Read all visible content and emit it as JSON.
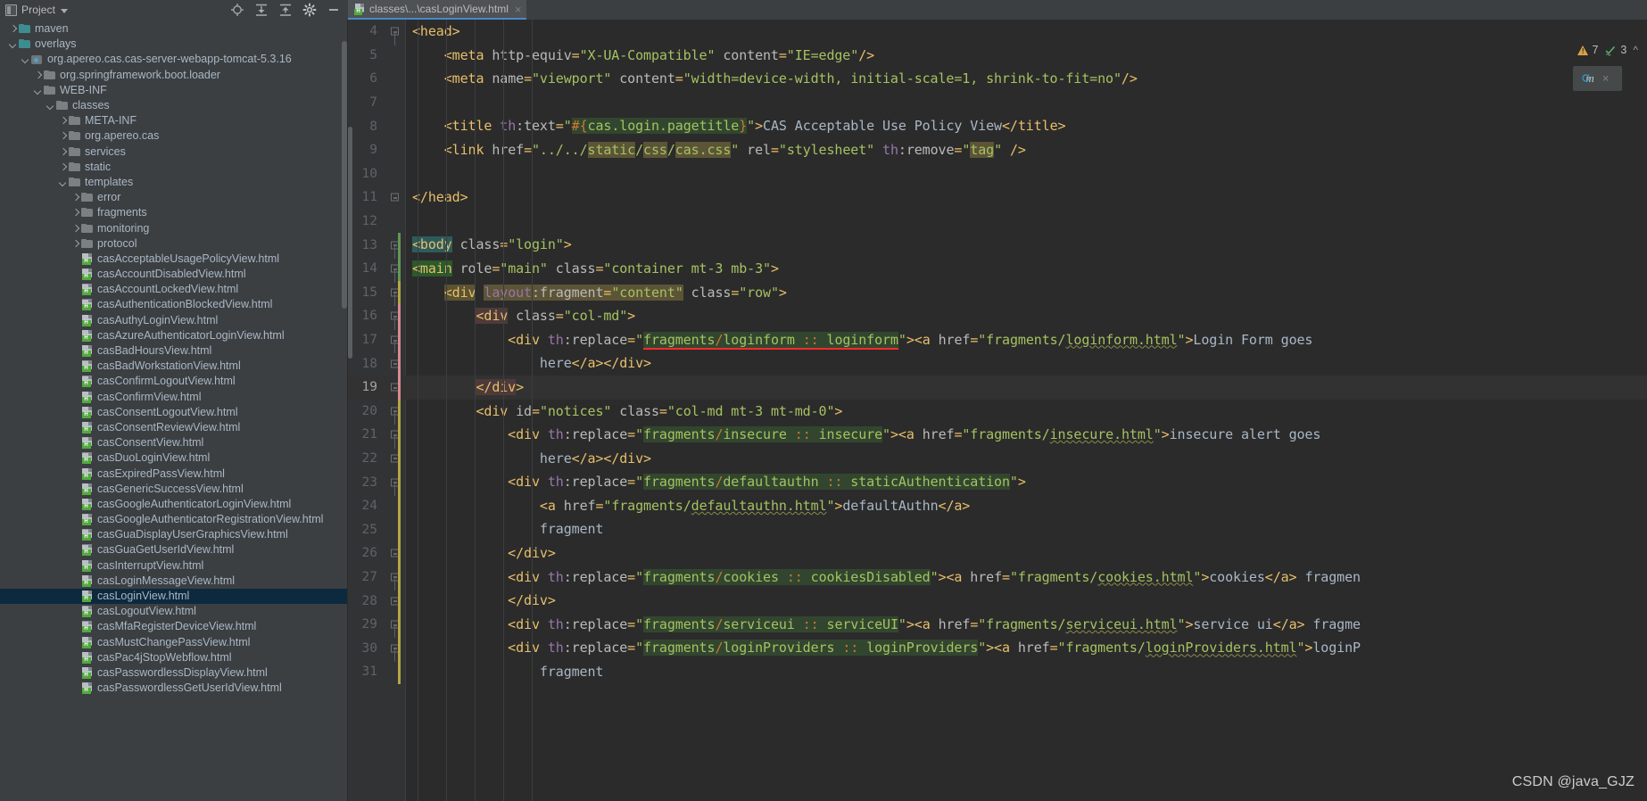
{
  "toolwindow": {
    "title": "Project",
    "icons": [
      "locate-icon",
      "expand-all-icon",
      "collapse-all-icon",
      "settings-gear-icon",
      "minimize-icon"
    ]
  },
  "tab": {
    "label": "classes\\...\\casLoginView.html",
    "icon": "html-file-icon",
    "close": "×"
  },
  "inspections": {
    "warning_icon": "warning-triangle-icon",
    "warning_count": "7",
    "ok_icon": "inspection-ok-icon",
    "ok_count": "3",
    "chevron": "^"
  },
  "maven_badge": {
    "letter": "m",
    "icon": "maven-reload-icon",
    "close": "×"
  },
  "watermark": "CSDN @java_GJZ",
  "tree": [
    {
      "indent": 1,
      "arrow": "right",
      "icon": "folder",
      "label": "maven"
    },
    {
      "indent": 1,
      "arrow": "down",
      "icon": "folder",
      "label": "overlays"
    },
    {
      "indent": 2,
      "arrow": "down",
      "icon": "module",
      "label": "org.apereo.cas.cas-server-webapp-tomcat-5.3.16"
    },
    {
      "indent": 3,
      "arrow": "right",
      "icon": "folder-gray",
      "label": "org.springframework.boot.loader"
    },
    {
      "indent": 3,
      "arrow": "down",
      "icon": "folder-gray",
      "label": "WEB-INF"
    },
    {
      "indent": 4,
      "arrow": "down",
      "icon": "folder-gray",
      "label": "classes"
    },
    {
      "indent": 5,
      "arrow": "right",
      "icon": "folder-gray",
      "label": "META-INF"
    },
    {
      "indent": 5,
      "arrow": "right",
      "icon": "folder-gray",
      "label": "org.apereo.cas"
    },
    {
      "indent": 5,
      "arrow": "right",
      "icon": "folder-gray",
      "label": "services"
    },
    {
      "indent": 5,
      "arrow": "right",
      "icon": "folder-gray",
      "label": "static"
    },
    {
      "indent": 5,
      "arrow": "down",
      "icon": "folder-gray",
      "label": "templates"
    },
    {
      "indent": 6,
      "arrow": "right",
      "icon": "folder-gray",
      "label": "error"
    },
    {
      "indent": 6,
      "arrow": "right",
      "icon": "folder-gray",
      "label": "fragments"
    },
    {
      "indent": 6,
      "arrow": "right",
      "icon": "folder-gray",
      "label": "monitoring"
    },
    {
      "indent": 6,
      "arrow": "right",
      "icon": "folder-gray",
      "label": "protocol"
    },
    {
      "indent": 6,
      "arrow": "none",
      "icon": "html-file",
      "label": "casAcceptableUsagePolicyView.html"
    },
    {
      "indent": 6,
      "arrow": "none",
      "icon": "html-file",
      "label": "casAccountDisabledView.html"
    },
    {
      "indent": 6,
      "arrow": "none",
      "icon": "html-file",
      "label": "casAccountLockedView.html"
    },
    {
      "indent": 6,
      "arrow": "none",
      "icon": "html-file",
      "label": "casAuthenticationBlockedView.html"
    },
    {
      "indent": 6,
      "arrow": "none",
      "icon": "html-file",
      "label": "casAuthyLoginView.html"
    },
    {
      "indent": 6,
      "arrow": "none",
      "icon": "html-file",
      "label": "casAzureAuthenticatorLoginView.html"
    },
    {
      "indent": 6,
      "arrow": "none",
      "icon": "html-file",
      "label": "casBadHoursView.html"
    },
    {
      "indent": 6,
      "arrow": "none",
      "icon": "html-file",
      "label": "casBadWorkstationView.html"
    },
    {
      "indent": 6,
      "arrow": "none",
      "icon": "html-file",
      "label": "casConfirmLogoutView.html"
    },
    {
      "indent": 6,
      "arrow": "none",
      "icon": "html-file",
      "label": "casConfirmView.html"
    },
    {
      "indent": 6,
      "arrow": "none",
      "icon": "html-file",
      "label": "casConsentLogoutView.html"
    },
    {
      "indent": 6,
      "arrow": "none",
      "icon": "html-file",
      "label": "casConsentReviewView.html"
    },
    {
      "indent": 6,
      "arrow": "none",
      "icon": "html-file",
      "label": "casConsentView.html"
    },
    {
      "indent": 6,
      "arrow": "none",
      "icon": "html-file",
      "label": "casDuoLoginView.html"
    },
    {
      "indent": 6,
      "arrow": "none",
      "icon": "html-file",
      "label": "casExpiredPassView.html"
    },
    {
      "indent": 6,
      "arrow": "none",
      "icon": "html-file",
      "label": "casGenericSuccessView.html"
    },
    {
      "indent": 6,
      "arrow": "none",
      "icon": "html-file",
      "label": "casGoogleAuthenticatorLoginView.html"
    },
    {
      "indent": 6,
      "arrow": "none",
      "icon": "html-file",
      "label": "casGoogleAuthenticatorRegistrationView.html"
    },
    {
      "indent": 6,
      "arrow": "none",
      "icon": "html-file",
      "label": "casGuaDisplayUserGraphicsView.html"
    },
    {
      "indent": 6,
      "arrow": "none",
      "icon": "html-file",
      "label": "casGuaGetUserIdView.html"
    },
    {
      "indent": 6,
      "arrow": "none",
      "icon": "html-file",
      "label": "casInterruptView.html"
    },
    {
      "indent": 6,
      "arrow": "none",
      "icon": "html-file",
      "label": "casLoginMessageView.html"
    },
    {
      "indent": 6,
      "arrow": "none",
      "icon": "html-file",
      "label": "casLoginView.html",
      "selected": true
    },
    {
      "indent": 6,
      "arrow": "none",
      "icon": "html-file",
      "label": "casLogoutView.html"
    },
    {
      "indent": 6,
      "arrow": "none",
      "icon": "html-file",
      "label": "casMfaRegisterDeviceView.html"
    },
    {
      "indent": 6,
      "arrow": "none",
      "icon": "html-file",
      "label": "casMustChangePassView.html"
    },
    {
      "indent": 6,
      "arrow": "none",
      "icon": "html-file",
      "label": "casPac4jStopWebflow.html"
    },
    {
      "indent": 6,
      "arrow": "none",
      "icon": "html-file",
      "label": "casPasswordlessDisplayView.html"
    },
    {
      "indent": 6,
      "arrow": "none",
      "icon": "html-file",
      "label": "casPasswordlessGetUserIdView.html"
    }
  ],
  "editor": {
    "first_line": 4,
    "lines": [
      {
        "n": 4,
        "fold": "start"
      },
      {
        "n": 5,
        "fold": "none"
      },
      {
        "n": 6,
        "fold": "none"
      },
      {
        "n": 7,
        "fold": "none"
      },
      {
        "n": 8,
        "fold": "none"
      },
      {
        "n": 9,
        "fold": "none"
      },
      {
        "n": 10,
        "fold": "none"
      },
      {
        "n": 11,
        "fold": "end"
      },
      {
        "n": 12,
        "fold": "none"
      },
      {
        "n": 13,
        "fold": "start"
      },
      {
        "n": 14,
        "fold": "start"
      },
      {
        "n": 15,
        "fold": "start"
      },
      {
        "n": 16,
        "fold": "start"
      },
      {
        "n": 17,
        "fold": "start"
      },
      {
        "n": 18,
        "fold": "end"
      },
      {
        "n": 19,
        "fold": "end",
        "caret": true
      },
      {
        "n": 20,
        "fold": "start"
      },
      {
        "n": 21,
        "fold": "start"
      },
      {
        "n": 22,
        "fold": "end"
      },
      {
        "n": 23,
        "fold": "start"
      },
      {
        "n": 24,
        "fold": "none"
      },
      {
        "n": 25,
        "fold": "none"
      },
      {
        "n": 26,
        "fold": "end"
      },
      {
        "n": 27,
        "fold": "start"
      },
      {
        "n": 28,
        "fold": "end"
      },
      {
        "n": 29,
        "fold": "start"
      },
      {
        "n": 30,
        "fold": "start"
      },
      {
        "n": 31,
        "fold": "none"
      }
    ],
    "code_text": {
      "l4": "<head>",
      "l5": "<meta http-equiv=\"X-UA-Compatible\" content=\"IE=edge\"/>",
      "l6": "<meta name=\"viewport\" content=\"width=device-width, initial-scale=1, shrink-to-fit=no\"/>",
      "l7": "",
      "l8": "<title th:text=\"#{cas.login.pagetitle}\">CAS Acceptable Use Policy View</title>",
      "l9": "<link href=\"../../static/css/cas.css\" rel=\"stylesheet\" th:remove=\"tag\" />",
      "l10": "",
      "l11": "</head>",
      "l12": "",
      "l13": "<body class=\"login\">",
      "l14": "<main role=\"main\" class=\"container mt-3 mb-3\">",
      "l15": "<div layout:fragment=\"content\" class=\"row\">",
      "l16": "<div class=\"col-md\">",
      "l17": "<div th:replace=\"fragments/loginform :: loginform\"><a href=\"fragments/loginform.html\">Login Form goes",
      "l18": "here</a></div>",
      "l19": "</div>",
      "l20": "<div id=\"notices\" class=\"col-md mt-3 mt-md-0\">",
      "l21": "<div th:replace=\"fragments/insecure :: insecure\"><a href=\"fragments/insecure.html\">insecure alert goes",
      "l22": "here</a></div>",
      "l23": "<div th:replace=\"fragments/defaultauthn :: staticAuthentication\">",
      "l24": "<a href=\"fragments/defaultauthn.html\">defaultAuthn</a>",
      "l25": "fragment",
      "l26": "</div>",
      "l27": "<div th:replace=\"fragments/cookies :: cookiesDisabled\"><a href=\"fragments/cookies.html\">cookies</a> fragmen",
      "l28": "</div>",
      "l29": "<div th:replace=\"fragments/serviceui :: serviceUI\"><a href=\"fragments/serviceui.html\">service ui</a> fragme",
      "l30": "<div th:replace=\"fragments/loginProviders :: loginProviders\"><a href=\"fragments/loginProviders.html\">loginP",
      "l31": "fragment"
    }
  },
  "colors": {
    "tag": "#e8bf6a",
    "attr_value": "#a5c261",
    "namespace": "#9876aa",
    "plain": "#a9b7c6",
    "editor_bg": "#2b2b2b",
    "panel_bg": "#3c3f41",
    "selection": "#0d293e",
    "tab_accent": "#4a88c7",
    "error": "#ff2b2b",
    "warning": "#d9a343",
    "ok": "#59a869"
  }
}
